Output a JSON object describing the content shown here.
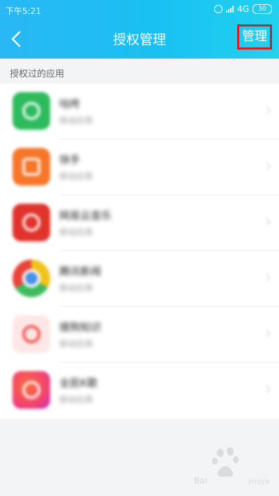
{
  "status_bar": {
    "time": "下午5:21",
    "network": "4G",
    "battery": "30"
  },
  "nav": {
    "title": "授权管理",
    "manage_label": "管理"
  },
  "section": {
    "label": "授权过的应用"
  },
  "apps": [
    {
      "name": "咕咚",
      "sub": "移动应用",
      "color": "#2dbb5d",
      "icon": "app-icon-gudong"
    },
    {
      "name": "快手",
      "sub": "移动应用",
      "color": "#f6762a",
      "icon": "app-icon-kuaishou"
    },
    {
      "name": "网易云音乐",
      "sub": "移动应用",
      "color": "#e0332b",
      "icon": "app-icon-netease-music"
    },
    {
      "name": "腾讯新闻",
      "sub": "移动应用",
      "color": "#4a8fe7",
      "icon": "app-icon-tencent-news"
    },
    {
      "name": "搜狗知识",
      "sub": "移动应用",
      "color": "#f0514c",
      "icon": "app-icon-sogou"
    },
    {
      "name": "全民K歌",
      "sub": "移动应用",
      "color": "#f2446e",
      "icon": "app-icon-kge"
    }
  ],
  "colors": {
    "header_start": "#2ab7f5",
    "header_end": "#21d2ee",
    "highlight": "#d81b24"
  }
}
